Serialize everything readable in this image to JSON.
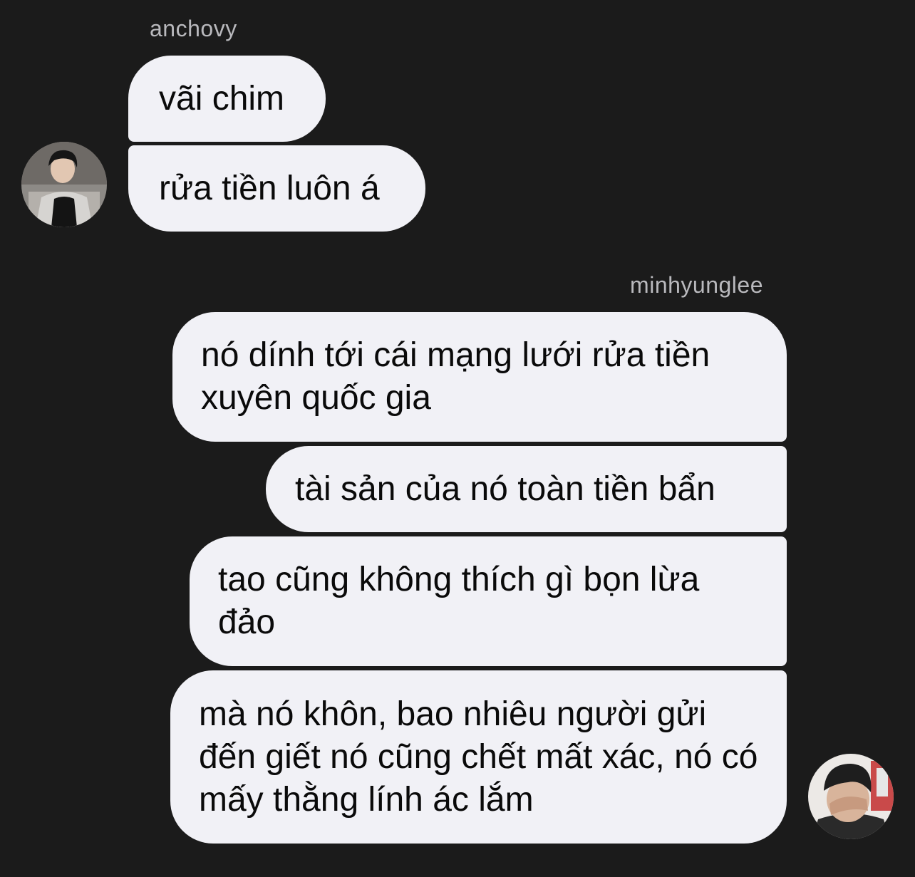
{
  "conversation": {
    "incoming": {
      "sender": "anchovy",
      "messages": [
        "vãi chim",
        "rửa tiền luôn á"
      ]
    },
    "outgoing": {
      "sender": "minhyunglee",
      "messages": [
        "nó dính tới cái mạng lưới rửa tiền xuyên quốc gia",
        "tài sản của nó toàn tiền bẩn",
        "tao cũng không thích gì bọn lừa đảo",
        "mà nó khôn, bao nhiêu người gửi đến giết nó cũng chết mất xác, nó có mấy thằng lính ác lắm"
      ]
    }
  },
  "colors": {
    "background": "#1b1b1b",
    "bubble": "#f1f1f6",
    "sender_label": "#b9b9bd",
    "text": "#0a0a0a"
  }
}
